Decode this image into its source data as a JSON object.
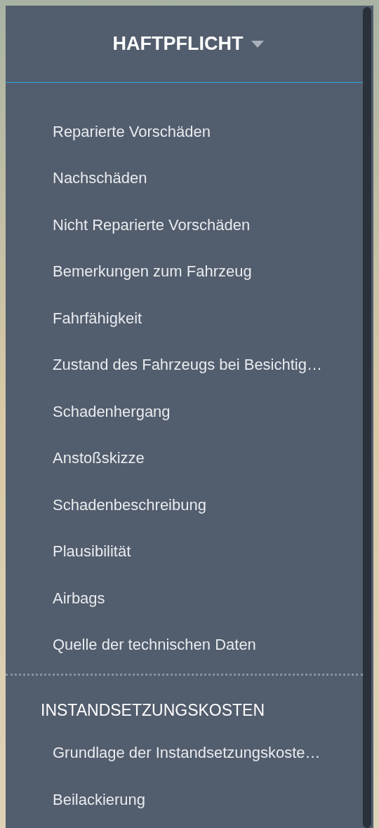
{
  "header": {
    "title": "HAFTPFLICHT"
  },
  "groups": [
    {
      "items": [
        "Reparierte Vorschäden",
        "Nachschäden",
        "Nicht Reparierte Vorschäden",
        "Bemerkungen zum Fahrzeug",
        "Fahrfähigkeit",
        "Zustand des Fahrzeugs bei Besichtig…",
        "Schadenhergang",
        "Anstoßskizze",
        "Schadenbeschreibung",
        "Plausibilität",
        "Airbags",
        "Quelle der technischen Daten"
      ]
    },
    {
      "heading": "INSTANDSETZUNGSKOSTEN",
      "items": [
        "Grundlage der Instandsetzungskoste…",
        "Beilackierung"
      ]
    }
  ]
}
